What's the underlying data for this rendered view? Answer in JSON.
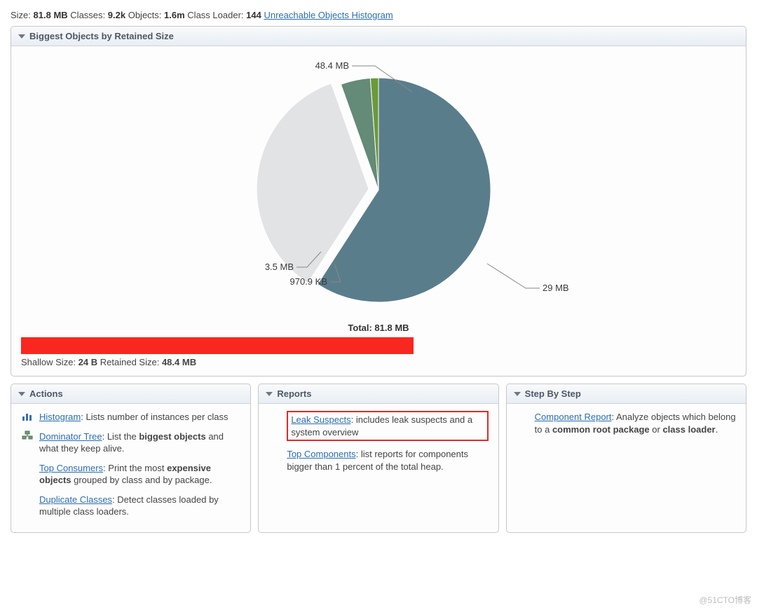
{
  "summary": {
    "size_label": "Size:",
    "size_value": "81.8 MB",
    "classes_label": "Classes:",
    "classes_value": "9.2k",
    "objects_label": "Objects:",
    "objects_value": "1.6m",
    "classloader_label": "Class Loader:",
    "classloader_value": "144",
    "link_text": "Unreachable Objects Histogram"
  },
  "biggest_panel": {
    "title": "Biggest Objects by Retained Size",
    "total_label": "Total: 81.8 MB",
    "shallow_label": "Shallow Size:",
    "shallow_value": "24 B",
    "retained_label": "Retained Size:",
    "retained_value": "48.4 MB",
    "colors": {
      "slice1": "#5a7d8c",
      "slice2": "#e1e3e5",
      "slice3": "#648a78",
      "slice4": "#6a9a3a"
    }
  },
  "chart_data": {
    "type": "pie",
    "title": "Biggest Objects by Retained Size",
    "total_label": "Total: 81.8 MB",
    "total_bytes_approx": 85800000,
    "series": [
      {
        "name": "slice1",
        "label": "48.4 MB",
        "value_mb": 48.4,
        "color": "#5a7d8c"
      },
      {
        "name": "slice2",
        "label": "29 MB",
        "value_mb": 29.0,
        "color": "#e1e3e5"
      },
      {
        "name": "slice3",
        "label": "3.5 MB",
        "value_mb": 3.5,
        "color": "#648a78"
      },
      {
        "name": "slice4",
        "label": "970.9 KB",
        "value_mb": 0.949,
        "color": "#6a9a3a"
      }
    ]
  },
  "actions_panel": {
    "title": "Actions",
    "items": [
      {
        "icon": "histogram-icon",
        "link": "Histogram",
        "text_pre": ": Lists number of instances per class",
        "bold1": "",
        "text_mid": "",
        "bold2": "",
        "text_post": ""
      },
      {
        "icon": "dominator-tree-icon",
        "link": "Dominator Tree",
        "text_pre": ": List the ",
        "bold1": "biggest objects",
        "text_mid": " and what they keep alive.",
        "bold2": "",
        "text_post": ""
      },
      {
        "icon": "",
        "link": "Top Consumers",
        "text_pre": ": Print the most ",
        "bold1": "expensive objects",
        "text_mid": " grouped by class and by package.",
        "bold2": "",
        "text_post": ""
      },
      {
        "icon": "",
        "link": "Duplicate Classes",
        "text_pre": ": Detect classes loaded by multiple class loaders.",
        "bold1": "",
        "text_mid": "",
        "bold2": "",
        "text_post": ""
      }
    ]
  },
  "reports_panel": {
    "title": "Reports",
    "items": [
      {
        "highlight": true,
        "link": "Leak Suspects",
        "text_pre": ": includes leak suspects and a system overview",
        "bold1": "",
        "text_mid": "",
        "bold2": "",
        "text_post": ""
      },
      {
        "highlight": false,
        "link": "Top Components",
        "text_pre": ": list reports for components bigger than 1 percent of the total heap.",
        "bold1": "",
        "text_mid": "",
        "bold2": "",
        "text_post": ""
      }
    ]
  },
  "step_panel": {
    "title": "Step By Step",
    "items": [
      {
        "link": "Component Report",
        "text_pre": ": Analyze objects which belong to a ",
        "bold1": "common root package",
        "text_mid": " or ",
        "bold2": "class loader",
        "text_post": "."
      }
    ]
  },
  "watermark": "@51CTO博客"
}
